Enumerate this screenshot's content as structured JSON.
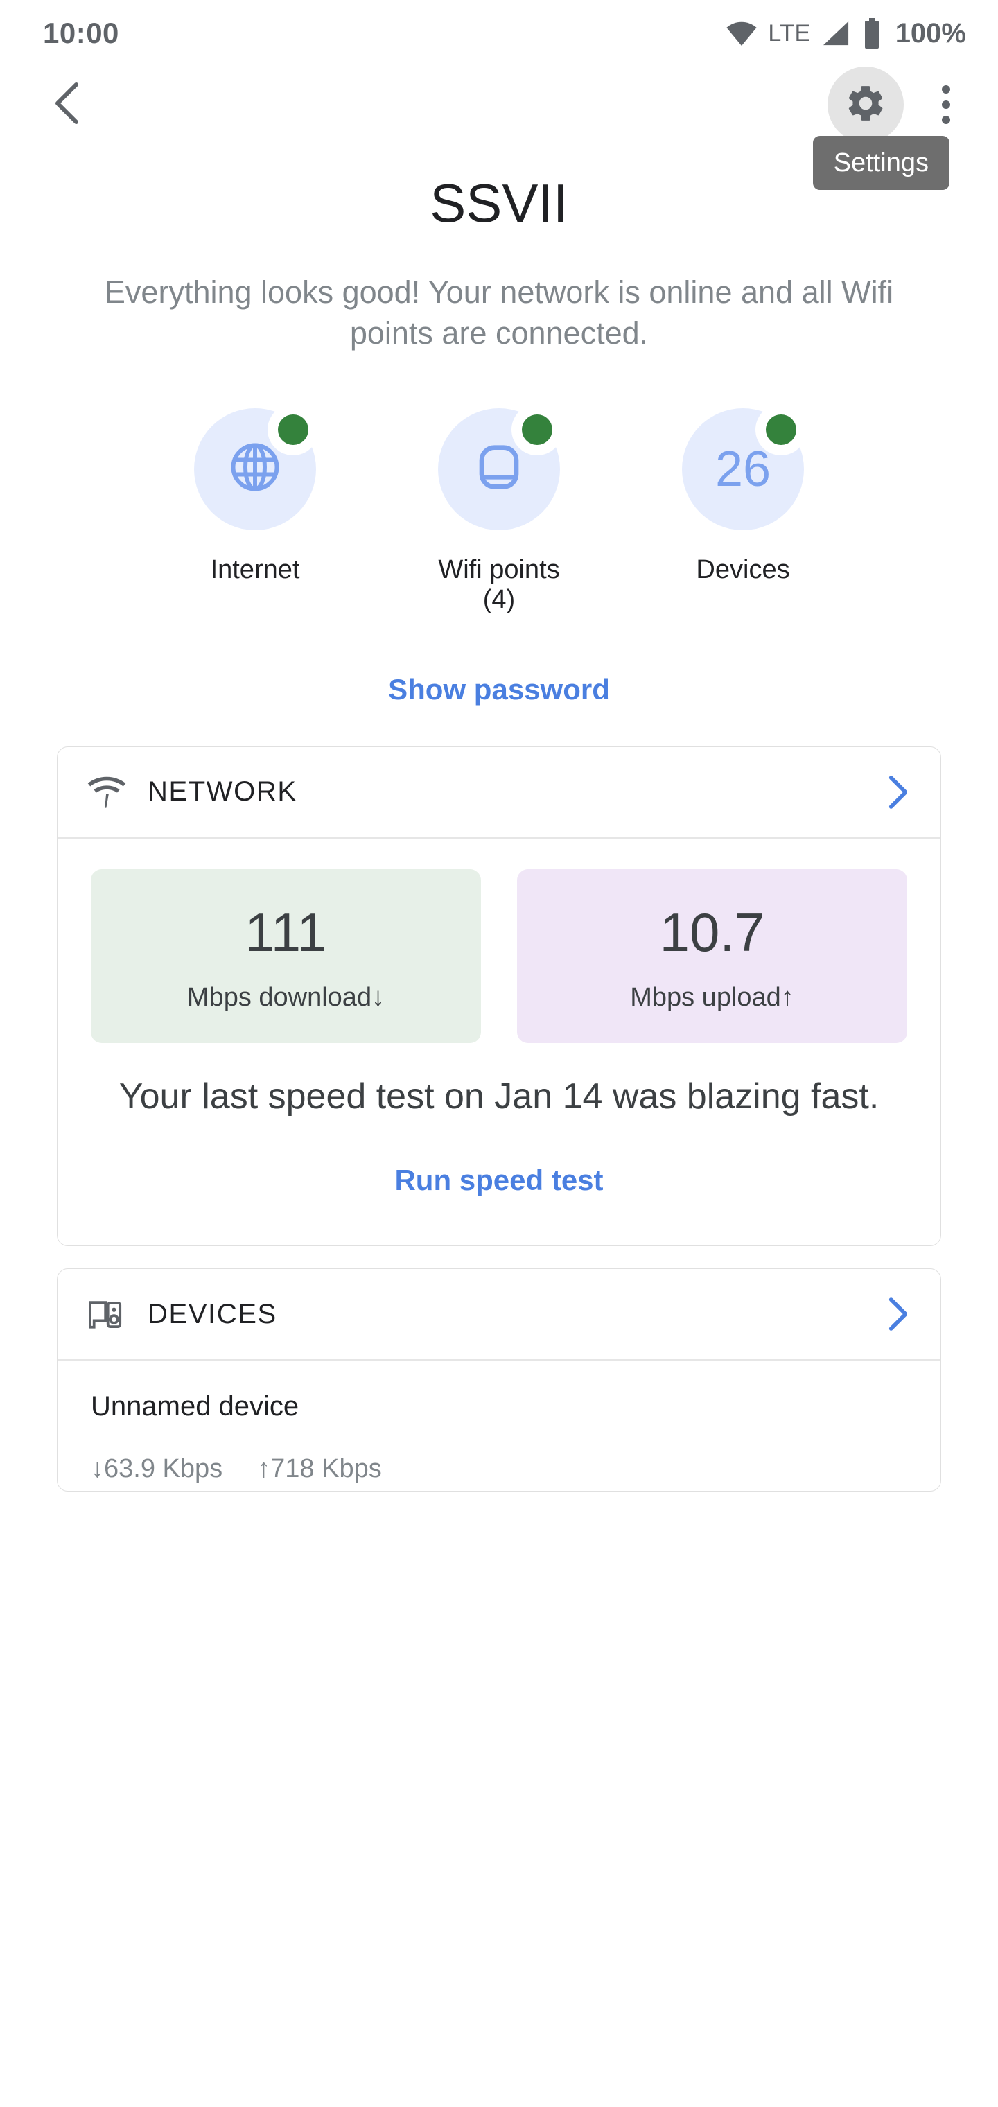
{
  "status_bar": {
    "time": "10:00",
    "network_type": "LTE",
    "battery_percent": "100%",
    "icons": [
      "wifi-icon",
      "signal-icon",
      "battery-icon"
    ]
  },
  "app_bar": {
    "back_icon": "back-chevron-icon",
    "settings_icon": "gear-icon",
    "overflow_icon": "more-vert-icon",
    "tooltip_label": "Settings"
  },
  "hero": {
    "title": "SSVII",
    "subtitle": "Everything looks good! Your network is online and all Wifi points are connected."
  },
  "status_circles": [
    {
      "icon": "globe-icon",
      "value": "",
      "label": "Internet",
      "status_color": "#34823c"
    },
    {
      "icon": "wifi-point-icon",
      "value": "",
      "label": "Wifi points (4)",
      "status_color": "#34823c"
    },
    {
      "icon": "device-count",
      "value": "26",
      "label": "Devices",
      "status_color": "#34823c"
    }
  ],
  "show_password_link": "Show password",
  "network_card": {
    "icon": "speed-test-icon",
    "title": "NETWORK",
    "chevron": "chevron-right-icon",
    "download": {
      "value": "111",
      "label": "Mbps download",
      "arrow": "↓",
      "bg": "#e7f0e8"
    },
    "upload": {
      "value": "10.7",
      "label": "Mbps upload",
      "arrow": "↑",
      "bg": "#f0e6f7"
    },
    "message": "Your last speed test on Jan 14 was blazing fast.",
    "action_link": "Run speed test"
  },
  "devices_card": {
    "icon": "devices-icon",
    "title": "DEVICES",
    "chevron": "chevron-right-icon",
    "items": [
      {
        "name": "Unnamed device",
        "download": "↓63.9 Kbps",
        "upload": "↑718 Kbps"
      }
    ]
  },
  "colors": {
    "accent_blue": "#4a7fe0",
    "icon_blue": "#7ba1ee",
    "circle_bg": "#e5ecfd",
    "status_green": "#34823c",
    "text_primary": "#202124",
    "text_secondary": "#80868b",
    "tooltip_bg": "#6e6e6e"
  }
}
